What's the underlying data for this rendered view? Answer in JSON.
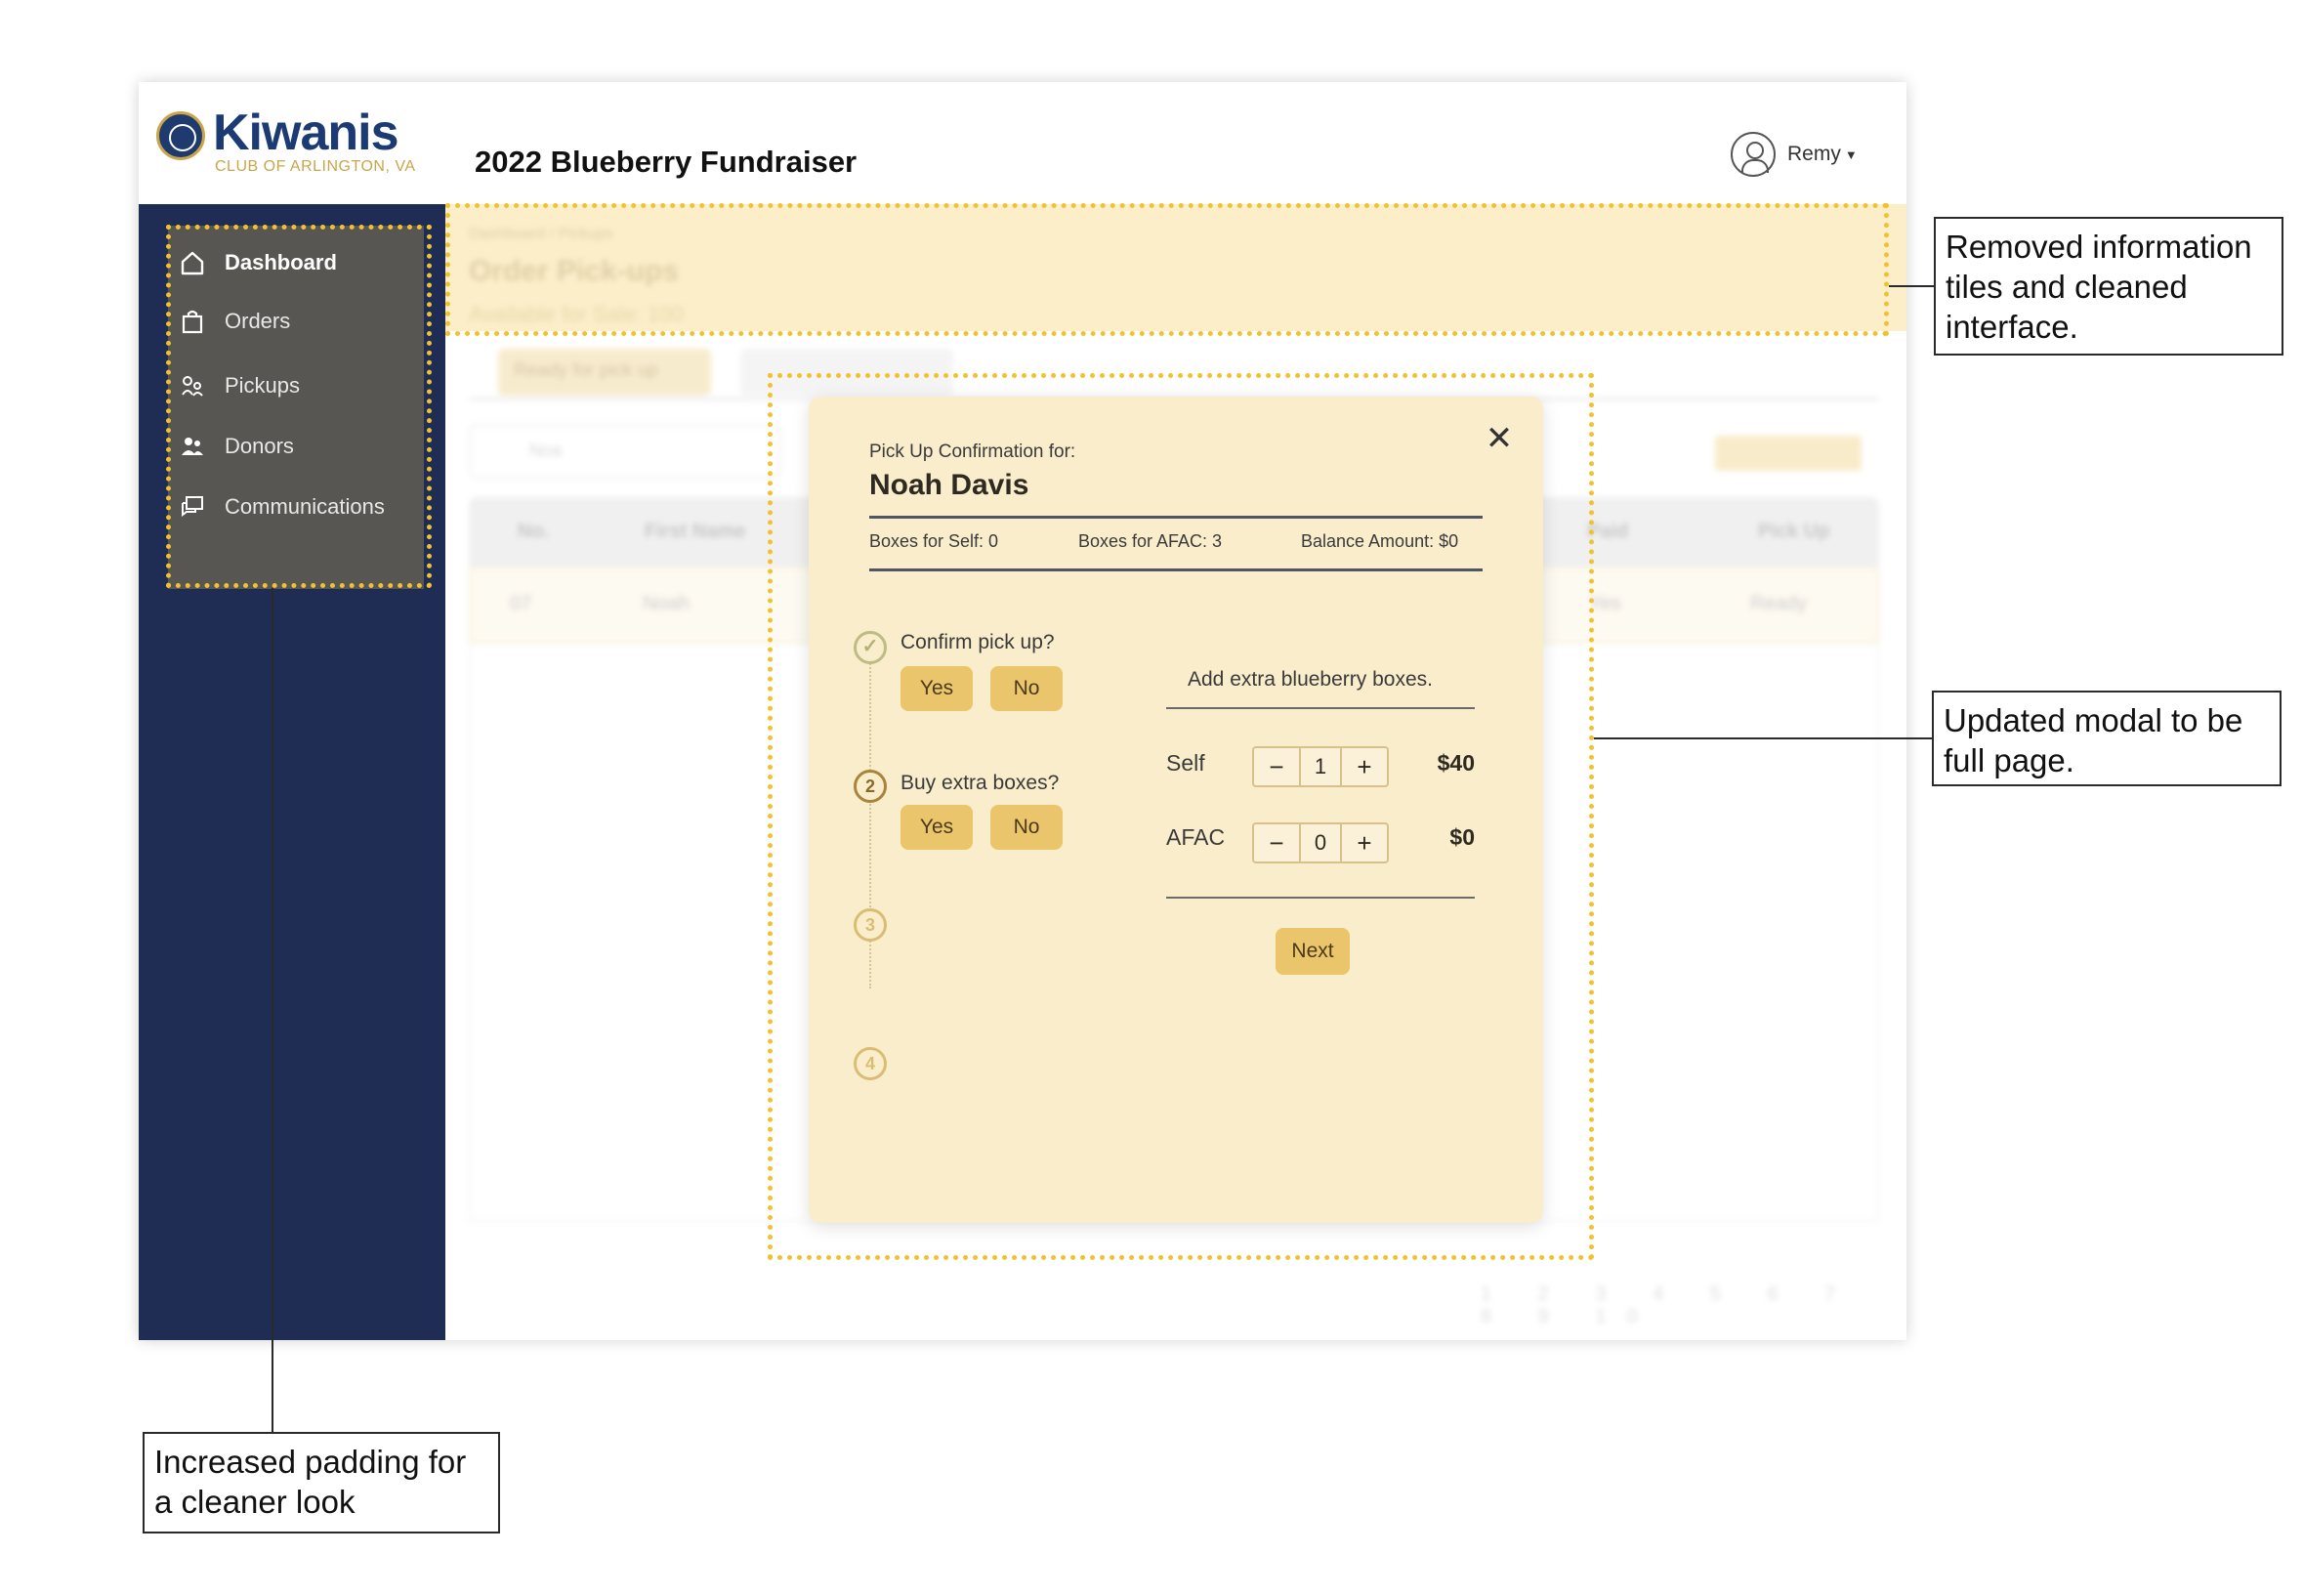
{
  "header": {
    "logo_word": "Kiwanis",
    "logo_sub": "CLUB OF ARLINGTON, VA",
    "title": "2022 Blueberry Fundraiser",
    "user_name": "Remy"
  },
  "sidebar": {
    "items": [
      {
        "label": "Dashboard",
        "icon": "home-icon"
      },
      {
        "label": "Orders",
        "icon": "bag-icon"
      },
      {
        "label": "Pickups",
        "icon": "pickup-icon"
      },
      {
        "label": "Donors",
        "icon": "people-icon"
      },
      {
        "label": "Communications",
        "icon": "chat-icon"
      }
    ]
  },
  "background": {
    "breadcrumb": "Dashboard / Pickups",
    "heading": "Order Pick-ups",
    "available": "Available for Sale: 100",
    "tab_ready": "Ready for pick up",
    "search_placeholder": "Noa",
    "columns": [
      "No.",
      "First Name",
      "Paid",
      "Pick Up"
    ],
    "row": {
      "no": "07",
      "first_name": "Noah",
      "paid": "Yes",
      "pick_up": "Ready"
    },
    "pages": "1 2 3 4 5 6 7 8 9 10"
  },
  "modal": {
    "label": "Pick Up Confirmation for:",
    "name": "Noah Davis",
    "boxes_self": "Boxes for Self: 0",
    "boxes_afac": "Boxes for AFAC: 3",
    "balance": "Balance Amount: $0",
    "steps": [
      {
        "number": "✓",
        "question": "Confirm pick up?",
        "yes": "Yes",
        "no": "No"
      },
      {
        "number": "2",
        "question": "Buy extra boxes?",
        "yes": "Yes",
        "no": "No"
      },
      {
        "number": "3"
      },
      {
        "number": "4"
      }
    ],
    "extra_title": "Add extra blueberry boxes.",
    "self": {
      "label": "Self",
      "minus": "−",
      "value": "1",
      "plus": "+",
      "price": "$40"
    },
    "afac": {
      "label": "AFAC",
      "minus": "−",
      "value": "0",
      "plus": "+",
      "price": "$0"
    },
    "next": "Next"
  },
  "annotations": {
    "top": "Removed information tiles and cleaned interface.",
    "modal": "Updated modal to be full page.",
    "sidebar": "Increased padding for a cleaner look"
  },
  "colors": {
    "sidebar_bg": "#1f2d55",
    "sidebar_panel": "#575653",
    "modal_bg": "#faedcb",
    "button": "#ebc56c",
    "highlight_dots": "#f2c12e",
    "brand_blue": "#1c3b74",
    "brand_gold": "#c9a64a"
  }
}
